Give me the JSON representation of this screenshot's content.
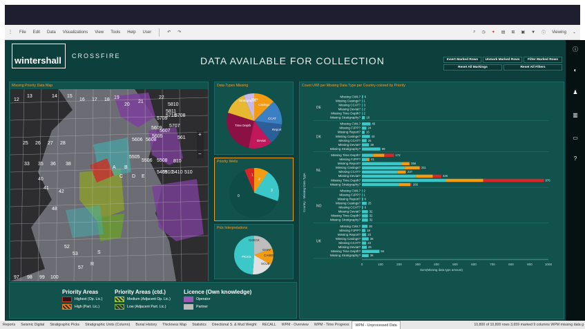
{
  "menu": {
    "items": [
      "File",
      "Edit",
      "Data",
      "Visualizations",
      "View",
      "Tools",
      "Help",
      "User"
    ],
    "viewing": "Viewing"
  },
  "header": {
    "logo": "wintershall",
    "crossfire": "CROSSFIRE",
    "title": "DATA AVAILABLE FOR COLLECTION"
  },
  "buttons": {
    "insert": "Insert Marked Rows",
    "unmark": "Unmark Marked Rows",
    "filter": "Filter Marked Rows",
    "reset_markings": "Reset All Markings",
    "reset_filters": "Reset All Filters"
  },
  "panels": {
    "map": "Missing Priority Data Map",
    "types": "Data Types Missing",
    "wells": "Priority Wells",
    "picks": "Pick Interpretations",
    "bars": "Count UWI per Missing Data Type per Country colored by Priority"
  },
  "map_labels": [
    "12",
    "13",
    "14",
    "15",
    "16",
    "17",
    "18",
    "19",
    "20",
    "21",
    "22",
    "5810",
    "5710",
    "5709",
    "5708",
    "5707",
    "5608",
    "5606",
    "561",
    "5508",
    "5505",
    "5510",
    "5409",
    "5410",
    "25",
    "26",
    "27",
    "28",
    "33",
    "35",
    "36",
    "38",
    "40",
    "41",
    "42",
    "48",
    "52",
    "53",
    "57",
    "S",
    "R",
    "A",
    "B",
    "C",
    "D",
    "E",
    "97",
    "98",
    "99",
    "100",
    "5811",
    "5609",
    "5607",
    "5605",
    "5506",
    "810",
    "510"
  ],
  "legend": {
    "priority": {
      "heading": "Priority Areas",
      "items": [
        "Highest (Op. Lic.)",
        "High (Part. Lic.)"
      ]
    },
    "priority2": {
      "heading": "Priority Areas (ctd.)",
      "items": [
        "Medium (Adjacent Op. Lic.)",
        "Low (Adjacent Part. Lic.)"
      ]
    },
    "licence": {
      "heading": "Licence (Own knowledge)",
      "items": [
        "Operator",
        "Partner"
      ]
    }
  },
  "pie_types": {
    "labels": [
      "Stratigraphic",
      "CWL",
      "Casings",
      "Time Depth",
      "Deviat",
      "CCAT",
      "Report",
      "FJPP"
    ]
  },
  "pie_wells": {
    "labels": [
      "1",
      "2",
      "3",
      "0"
    ]
  },
  "pie_picks": {
    "labels": [
      "CHECK",
      "GHAY",
      "CASED",
      "PICKS",
      "SCUE"
    ]
  },
  "colors": {
    "dark": "#8b1145",
    "teal": "#3cc8c8",
    "orange": "#f39c12",
    "red": "#d62728",
    "purple": "#9b59b6"
  },
  "chart_data": {
    "type": "bar",
    "ylabel": "Country - Missing Data Type",
    "xlabel": "Sum(Missing data type amount)",
    "xlim": [
      0,
      1000
    ],
    "xticks": [
      "0",
      "100",
      "200",
      "300",
      "400",
      "500",
      "600",
      "700",
      "800",
      "900",
      "1000"
    ],
    "groups": [
      {
        "country": "DE",
        "rows": [
          [
            "Missing CWL?",
            6,
            0,
            0
          ],
          [
            "Missing Casings?",
            1,
            0,
            0
          ],
          [
            "Missing CCAT?",
            3,
            0,
            0
          ],
          [
            "Missing Deviat?",
            2,
            0,
            0
          ],
          [
            "Missing Time Depth?",
            2,
            0,
            0
          ],
          [
            "Missing Stratigraphy?",
            16,
            0,
            0
          ]
        ]
      },
      {
        "country": "DK",
        "rows": [
          [
            "Missing CWL?",
            46,
            0,
            0
          ],
          [
            "Missing FJPP?",
            24,
            0,
            0
          ],
          [
            "Missing Report?",
            15,
            0,
            0
          ],
          [
            "Missing Casings?",
            43,
            0,
            0
          ],
          [
            "Missing CCAT?",
            25,
            0,
            0
          ],
          [
            "Missing Deviat?",
            38,
            0,
            0
          ],
          [
            "Missing Stratigraphy?",
            99,
            0,
            0
          ]
        ]
      },
      {
        "country": "NL",
        "rows": [
          [
            "Missing Time Depth?",
            60,
            60,
            52
          ],
          [
            "Missing FJPP?",
            30,
            10,
            1
          ],
          [
            "Missing Report?",
            215,
            40,
            1
          ],
          [
            "Missing Casings?",
            230,
            80,
            1
          ],
          [
            "Missing CCAT?",
            190,
            45,
            2
          ],
          [
            "Missing Deviat?",
            290,
            90,
            46
          ],
          [
            "Missing Time Depth?",
            450,
            200,
            326
          ],
          [
            "Missing Stratigraphy?",
            200,
            60,
            6
          ]
        ]
      },
      {
        "country": "NO",
        "rows": [
          [
            "Missing CWL?",
            2,
            0,
            0
          ],
          [
            "Missing FJPP?",
            1,
            0,
            0
          ],
          [
            "Missing Report?",
            6,
            0,
            0
          ],
          [
            "Missing Casings?",
            25,
            0,
            0
          ],
          [
            "Missing CCAT?",
            6,
            0,
            0
          ],
          [
            "Missing Deviat?",
            32,
            0,
            0
          ],
          [
            "Missing Time Depth?",
            32,
            0,
            0
          ],
          [
            "Missing Stratigraphy?",
            32,
            0,
            0
          ]
        ]
      },
      {
        "country": "UK",
        "rows": [
          [
            "Missing CWL?",
            30,
            0,
            0
          ],
          [
            "Missing FJPP?",
            19,
            0,
            0
          ],
          [
            "Missing Report?",
            23,
            0,
            0
          ],
          [
            "Missing Casings?",
            36,
            0,
            0
          ],
          [
            "Missing CCAT?",
            23,
            0,
            0
          ],
          [
            "Missing Deviat?",
            26,
            0,
            0
          ],
          [
            "Missing Time Depth?",
            94,
            0,
            0
          ],
          [
            "Missing Stratigraphy?",
            36,
            0,
            0
          ]
        ]
      }
    ],
    "series": [
      {
        "name": "teal",
        "color": "#3cc8c8"
      },
      {
        "name": "orange",
        "color": "#f39c12"
      },
      {
        "name": "red",
        "color": "#d62728"
      }
    ]
  },
  "tabs": [
    "Reports",
    "Seismic Digital",
    "Stratigraphic Picks",
    "Stratigraphic Units (Column)",
    "Burial History",
    "Thickness Map",
    "Statistics",
    "Directional S. & Mud Weight",
    "RECALL",
    "WPM - Overview",
    "WPM - Time Progress",
    "WPM - Unprocessed Data"
  ],
  "active_tab": 11,
  "status": "10,800 of 10,800 rows  3,659 marked  9 columns  WPM missing data g"
}
